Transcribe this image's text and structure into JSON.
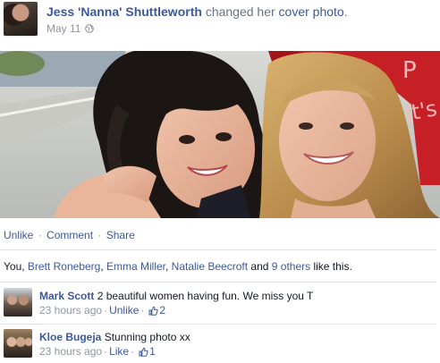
{
  "story": {
    "author": "Jess 'Nanna' Shuttleworth",
    "verb_text": "changed her",
    "object_link": "cover photo",
    "period": ".",
    "timestamp": "May 11",
    "privacy_icon": "globe-icon"
  },
  "photo": {
    "description_icon": "cover-photo",
    "background_text": "it's"
  },
  "actions": {
    "unlike": "Unlike",
    "comment": "Comment",
    "share": "Share",
    "separator": "·"
  },
  "likes": {
    "prefix": "You, ",
    "people": [
      "Brett Roneberg",
      "Emma Miller",
      "Natalie Beecroft"
    ],
    "comma": ", ",
    "and": " and ",
    "others_link": "9 others",
    "suffix": " like this."
  },
  "comments": [
    {
      "author": "Mark Scott",
      "text": "2 beautiful women having fun. We miss you T",
      "time": "23 hours ago",
      "action": "Unlike",
      "like_count": "2"
    },
    {
      "author": "Kloe Bugeja",
      "text": "Stunning photo xx",
      "time": "23 hours ago",
      "action": "Like",
      "like_count": "1"
    }
  ],
  "colors": {
    "link": "#3b5998",
    "muted": "#90949c",
    "divider": "#e1e4ea"
  }
}
